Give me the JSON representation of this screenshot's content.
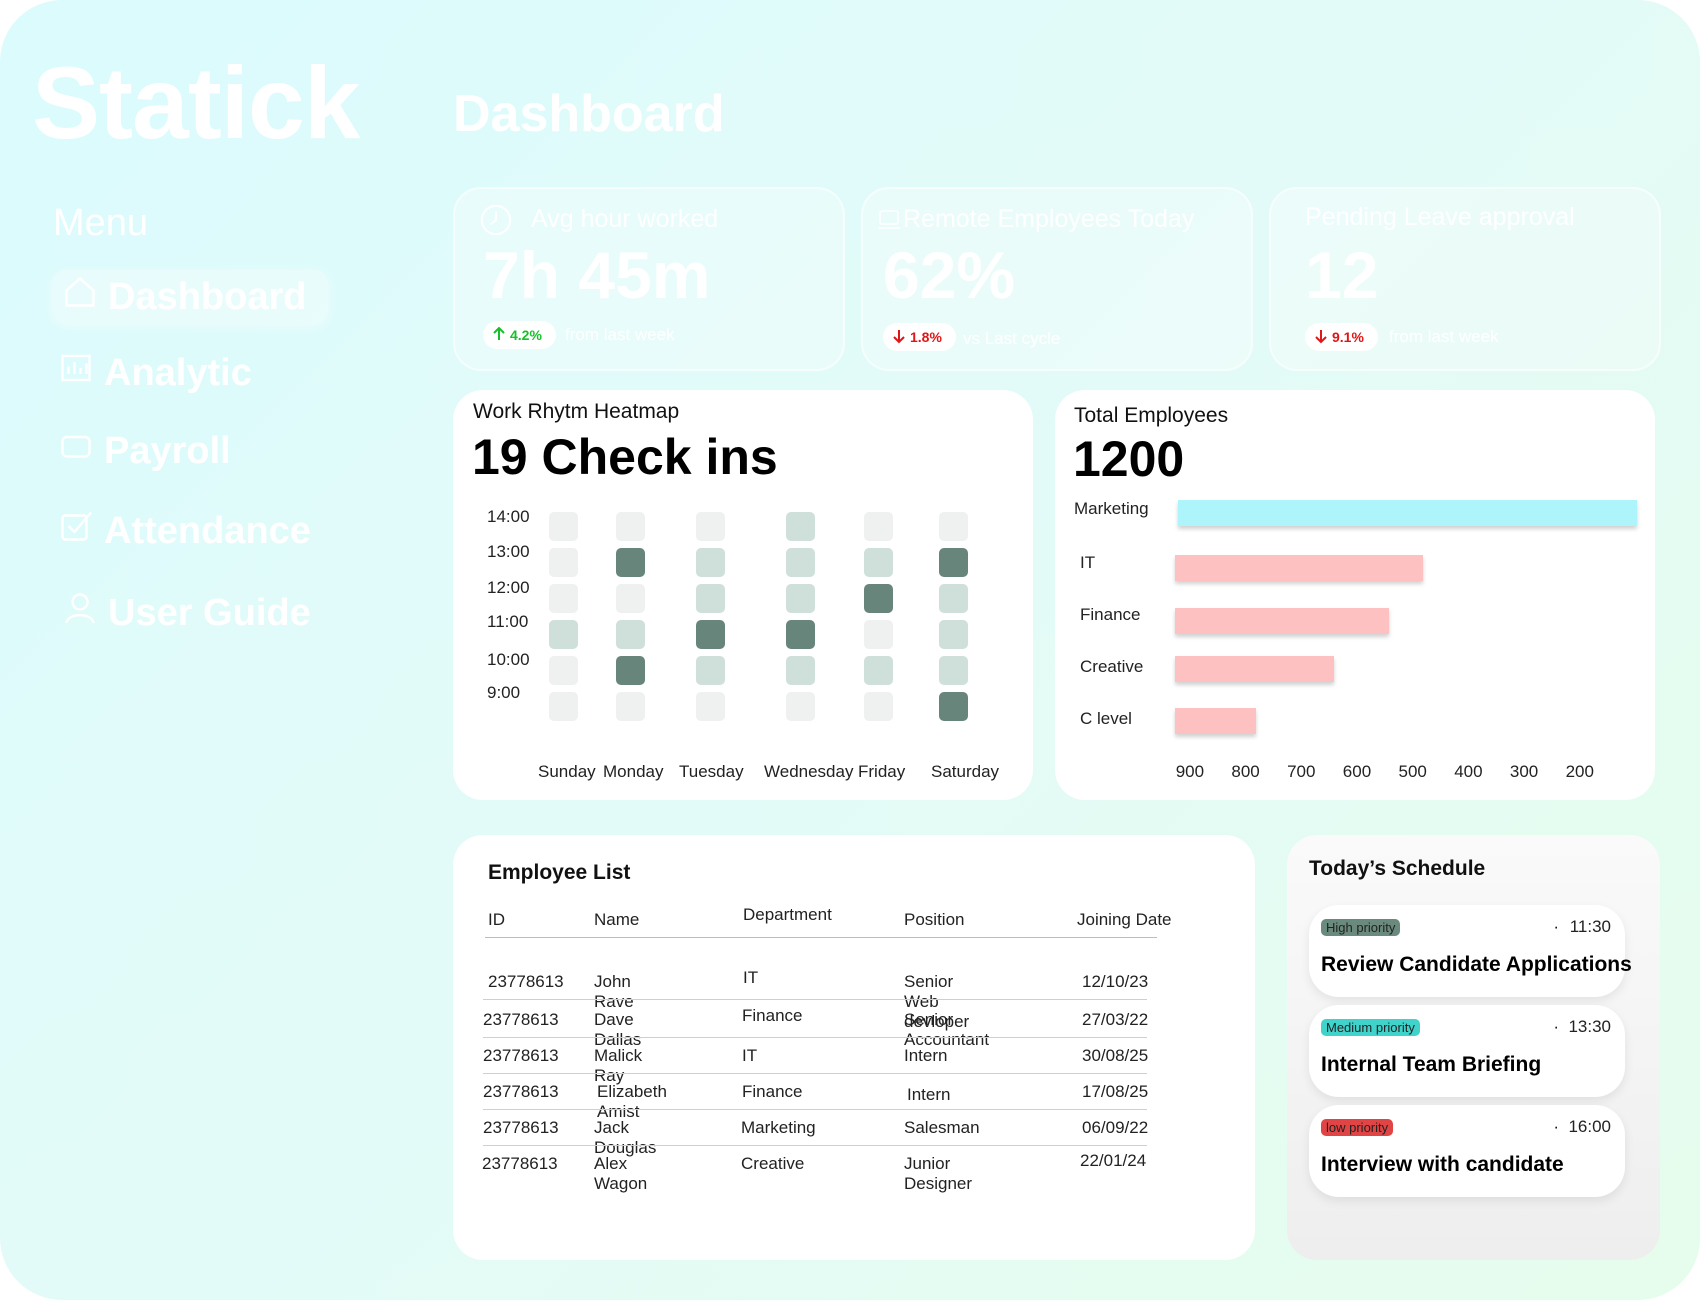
{
  "app": {
    "logo": "Statick",
    "page_title": "Dashboard"
  },
  "sidebar": {
    "menu_label": "Menu",
    "items": [
      {
        "label": "Dashboard",
        "icon": "home-icon",
        "active": true
      },
      {
        "label": "Analytic",
        "icon": "chart-icon",
        "active": false
      },
      {
        "label": "Payroll",
        "icon": "wallet-icon",
        "active": false
      },
      {
        "label": "Attendance",
        "icon": "checkbox-icon",
        "active": false
      },
      {
        "label": "User Guide",
        "icon": "user-icon",
        "active": false
      }
    ]
  },
  "stats": [
    {
      "title": "Avg hour worked",
      "icon": "clock-icon",
      "value": "7h 45m",
      "change": "4.2%",
      "direction": "up",
      "note": "from last week"
    },
    {
      "title": "Remote Employees Today",
      "icon": "laptop-icon",
      "value": "62%",
      "change": "1.8%",
      "direction": "down",
      "note": "vs Last cycle"
    },
    {
      "title": "Pending Leave approval",
      "icon": "",
      "value": "12",
      "change": "9.1%",
      "direction": "down",
      "note": "from last week"
    }
  ],
  "heatmap": {
    "title": "Work Rhytm Heatmap",
    "headline": "19 Check ins",
    "times": [
      "14:00",
      "13:00",
      "12:00",
      "11:00",
      "10:00",
      "9:00"
    ],
    "days": [
      "Sunday",
      "Monday",
      "Tuesday",
      "Wednesday",
      "Friday",
      "Saturday"
    ],
    "levels": [
      [
        0,
        0,
        0,
        1,
        0,
        0
      ],
      [
        0,
        3,
        1,
        1,
        1,
        3
      ],
      [
        0,
        0,
        1,
        1,
        3,
        1
      ],
      [
        1,
        1,
        3,
        3,
        0,
        1
      ],
      [
        0,
        3,
        1,
        1,
        1,
        1
      ],
      [
        0,
        0,
        0,
        0,
        0,
        3
      ]
    ],
    "colors": {
      "0": "#eef1f0",
      "1": "#cfdfd9",
      "3": "#67857a"
    }
  },
  "employees_chart": {
    "title": "Total Employees",
    "headline": "1200"
  },
  "chart_data": {
    "type": "bar",
    "orientation": "horizontal",
    "categories": [
      "Marketing",
      "IT",
      "Finance",
      "Creative",
      "C level"
    ],
    "values": [
      100,
      485,
      545,
      645,
      785
    ],
    "colors": [
      "#aef4fb",
      "#fec1c1",
      "#fec1c1",
      "#fec1c1",
      "#fec1c1"
    ],
    "x_ticks": [
      "900",
      "800",
      "700",
      "600",
      "500",
      "400",
      "300",
      "200"
    ],
    "xlim": [
      930,
      140
    ],
    "xlabel": "",
    "ylabel": ""
  },
  "employee_list": {
    "title": "Employee List",
    "columns": [
      "ID",
      "Name",
      "Department",
      "Position",
      "Joining Date"
    ],
    "rows": [
      [
        "23778613",
        "John Rave",
        "IT",
        "Senior Web devloper",
        "12/10/23"
      ],
      [
        "23778613",
        "Dave Dallas",
        "Finance",
        "Senior Accountant",
        "27/03/22"
      ],
      [
        "23778613",
        "Malick Ray",
        "IT",
        "Intern",
        "30/08/25"
      ],
      [
        "23778613",
        "Elizabeth Amist",
        "Finance",
        "Intern",
        "17/08/25"
      ],
      [
        "23778613",
        "Jack Douglas",
        "Marketing",
        "Salesman",
        "06/09/22"
      ],
      [
        "23778613",
        "Alex Wagon",
        "Creative",
        "Junior Designer",
        "22/01/24"
      ]
    ]
  },
  "schedule": {
    "title": "Today’s Schedule",
    "items": [
      {
        "priority": "High priority",
        "priority_color": "#6a8a7e",
        "time": "11:30",
        "title": "Review Candidate Applications"
      },
      {
        "priority": "Medium priority",
        "priority_color": "#3fd3cc",
        "time": "13:30",
        "title": "Internal Team Briefing"
      },
      {
        "priority": "low priority",
        "priority_color": "#e04444",
        "time": "16:00",
        "title": "Interview with candidate"
      }
    ]
  },
  "colors": {
    "up": "#17c02a",
    "down": "#e01515"
  }
}
